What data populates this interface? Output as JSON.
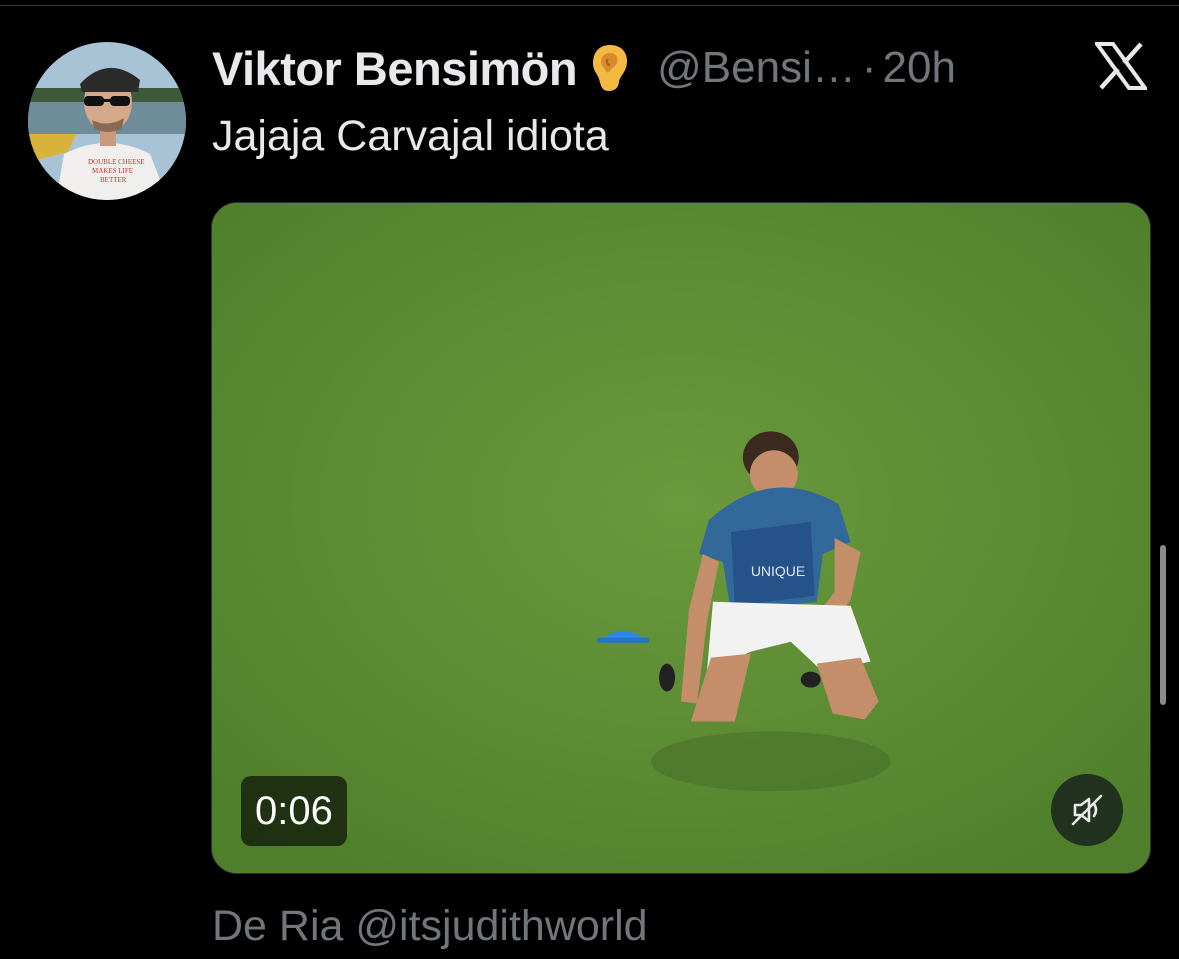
{
  "tweet": {
    "author_name": "Viktor Bensimön",
    "author_handle": "@Bensi…",
    "separator": "·",
    "timestamp": "20h",
    "text": "Jajaja Carvajal idiota",
    "verified_emoji": "ear-icon",
    "avatar_shirt_text": [
      "DOUBLE CHEESE",
      "MAKES LIFE",
      "BETTER"
    ]
  },
  "media": {
    "type": "video",
    "duration": "0:06",
    "muted": true,
    "colors": {
      "grass": "#5f8e36",
      "cone": "#2f86e6"
    }
  },
  "quote": {
    "author_name": "De Ria",
    "author_handle": "@itsjudithworld"
  },
  "brand": {
    "logo": "x-logo-icon"
  },
  "colors": {
    "background": "#000000",
    "text_primary": "#e7e9ea",
    "text_secondary": "#71767b"
  }
}
